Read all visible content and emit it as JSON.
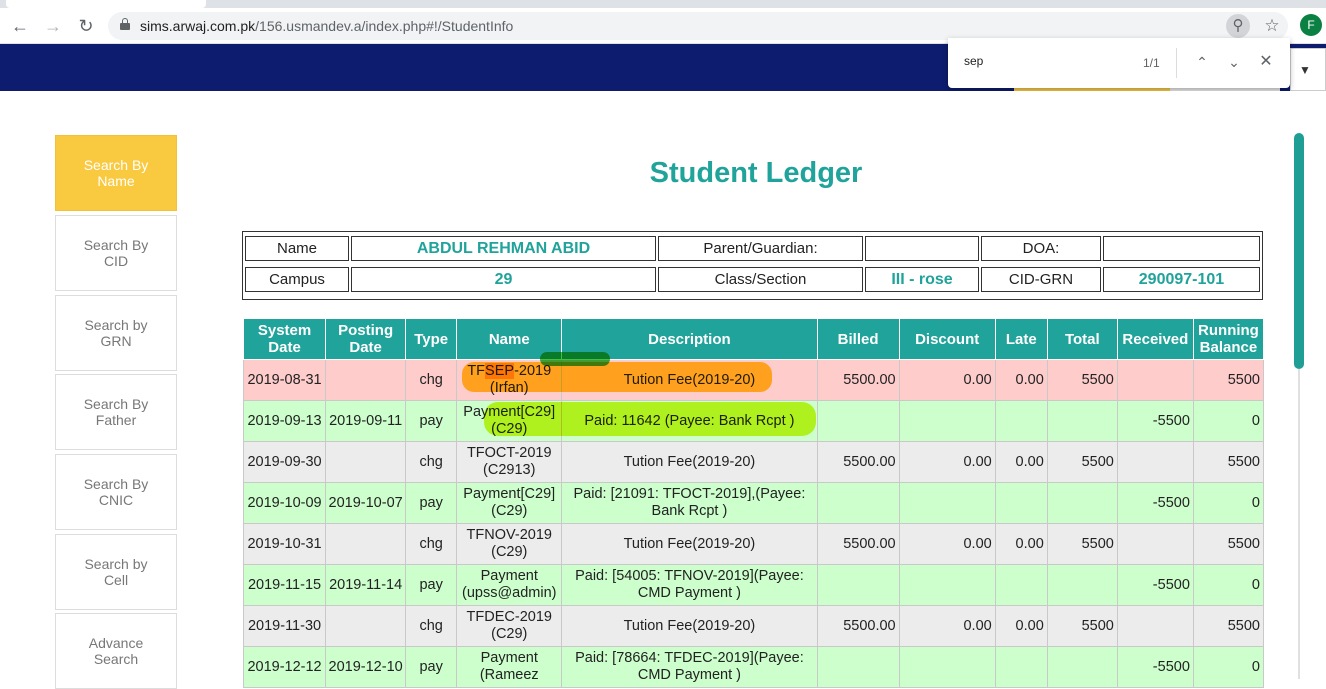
{
  "browser": {
    "url_host": "sims.arwaj.com.pk",
    "url_path": "/156.usmandev.a/index.php#!/StudentInfo",
    "profile_initial": "F"
  },
  "find_bar": {
    "query": "sep",
    "count": "1/1"
  },
  "sidebar": {
    "items": [
      {
        "label": "Search By Name"
      },
      {
        "label": "Search By CID"
      },
      {
        "label": "Search by GRN"
      },
      {
        "label": "Search By Father"
      },
      {
        "label": "Search By CNIC"
      },
      {
        "label": "Search by Cell"
      },
      {
        "label": "Advance Search"
      }
    ]
  },
  "page": {
    "title": "Student Ledger"
  },
  "student_info": {
    "name_label": "Name",
    "name_value": "ABDUL REHMAN ABID",
    "parent_label": "Parent/Guardian:",
    "parent_value": "",
    "doa_label": "DOA:",
    "doa_value": "",
    "campus_label": "Campus",
    "campus_value": "29",
    "class_label": "Class/Section",
    "class_value": "III - rose",
    "cidgrn_label": "CID-GRN",
    "cidgrn_value": "290097-101"
  },
  "ledger": {
    "headers": [
      "System Date",
      "Posting Date",
      "Type",
      "Name",
      "Description",
      "Billed",
      "Discount",
      "Late",
      "Total",
      "Received",
      "Running Balance"
    ],
    "rows": [
      {
        "system_date": "2019-08-31",
        "posting_date": "",
        "type": "chg",
        "name": "TFSEP-2019 (Irfan)",
        "description": "Tution Fee(2019-20)",
        "billed": "5500.00",
        "discount": "0.00",
        "late": "0.00",
        "total": "5500",
        "received": "",
        "balance": "5500"
      },
      {
        "system_date": "2019-09-13",
        "posting_date": "2019-09-11",
        "type": "pay",
        "name": "Payment[C29] (C29)",
        "description": "Paid: 11642 (Payee: Bank Rcpt )",
        "billed": "",
        "discount": "",
        "late": "",
        "total": "",
        "received": "-5500",
        "balance": "0"
      },
      {
        "system_date": "2019-09-30",
        "posting_date": "",
        "type": "chg",
        "name": "TFOCT-2019 (C2913)",
        "description": "Tution Fee(2019-20)",
        "billed": "5500.00",
        "discount": "0.00",
        "late": "0.00",
        "total": "5500",
        "received": "",
        "balance": "5500"
      },
      {
        "system_date": "2019-10-09",
        "posting_date": "2019-10-07",
        "type": "pay",
        "name": "Payment[C29] (C29)",
        "description": "Paid: [21091: TFOCT-2019],(Payee: Bank Rcpt )",
        "billed": "",
        "discount": "",
        "late": "",
        "total": "",
        "received": "-5500",
        "balance": "0"
      },
      {
        "system_date": "2019-10-31",
        "posting_date": "",
        "type": "chg",
        "name": "TFNOV-2019 (C29)",
        "description": "Tution Fee(2019-20)",
        "billed": "5500.00",
        "discount": "0.00",
        "late": "0.00",
        "total": "5500",
        "received": "",
        "balance": "5500"
      },
      {
        "system_date": "2019-11-15",
        "posting_date": "2019-11-14",
        "type": "pay",
        "name": "Payment (upss@admin)",
        "description": "Paid: [54005: TFNOV-2019](Payee: CMD Payment )",
        "billed": "",
        "discount": "",
        "late": "",
        "total": "",
        "received": "-5500",
        "balance": "0"
      },
      {
        "system_date": "2019-11-30",
        "posting_date": "",
        "type": "chg",
        "name": "TFDEC-2019 (C29)",
        "description": "Tution Fee(2019-20)",
        "billed": "5500.00",
        "discount": "0.00",
        "late": "0.00",
        "total": "5500",
        "received": "",
        "balance": "5500"
      },
      {
        "system_date": "2019-12-12",
        "posting_date": "2019-12-10",
        "type": "pay",
        "name": "Payment (Rameez",
        "description": "Paid: [78664: TFDEC-2019](Payee: CMD Payment )",
        "billed": "",
        "discount": "",
        "late": "",
        "total": "",
        "received": "-5500",
        "balance": "0"
      }
    ]
  },
  "colors": {
    "header_band": "#0d1c6e",
    "accent_teal": "#20a39a",
    "active_sidebar": "#f9c940",
    "row_charge_first": "#ffcccc",
    "row_payment": "#ccffcc",
    "row_charge": "#ececec"
  }
}
